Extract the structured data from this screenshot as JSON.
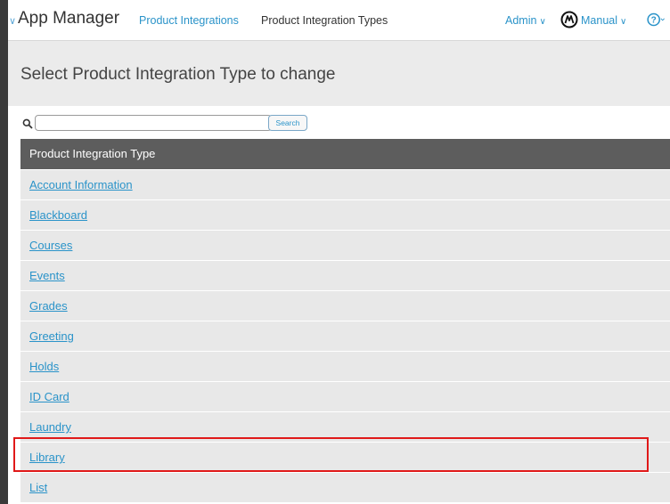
{
  "topbar": {
    "app_title": "App Manager",
    "breadcrumb_link": "Product Integrations",
    "breadcrumb_current": "Product Integration Types",
    "admin_label": "Admin",
    "manual_label": "Manual"
  },
  "header": {
    "title": "Select Product Integration Type to change"
  },
  "search": {
    "value": "",
    "button_label": "Search"
  },
  "table": {
    "column_header": "Product Integration Type",
    "rows": [
      "Account Information",
      "Blackboard",
      "Courses",
      "Events",
      "Grades",
      "Greeting",
      "Holds",
      "ID Card",
      "Laundry",
      "Library",
      "List"
    ],
    "highlighted_row": "Library"
  },
  "colors": {
    "accent_link": "#2a93c9",
    "table_header_bg": "#5d5d5d",
    "row_bg": "#e8e8e8",
    "highlight": "#e01919"
  },
  "icons": {
    "search": "magnifier-icon",
    "manual": "manual-logo-icon",
    "help": "question-circle-icon"
  }
}
